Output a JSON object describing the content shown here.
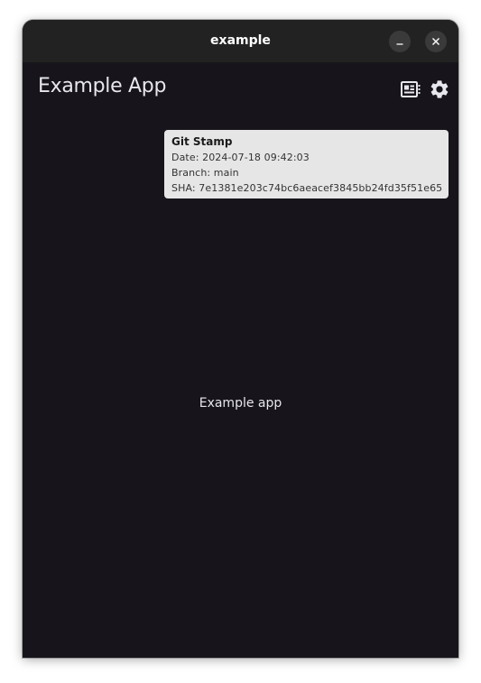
{
  "window": {
    "title": "example"
  },
  "app": {
    "title": "Example App",
    "body_text": "Example app"
  },
  "toolbar": {
    "icons": [
      "git-stamp-icon",
      "settings-gear-icon"
    ]
  },
  "tooltip": {
    "title": "Git Stamp",
    "date_line": "Date: 2024-07-18 09:42:03",
    "branch_line": "Branch: main",
    "sha_line": "SHA: 7e1381e203c74bc6aeacef3845bb24fd35f51e65"
  },
  "colors": {
    "background": "#17151b",
    "titlebar": "#222222",
    "tooltip_bg": "#e6e6e6",
    "text": "#e8e6ee"
  }
}
